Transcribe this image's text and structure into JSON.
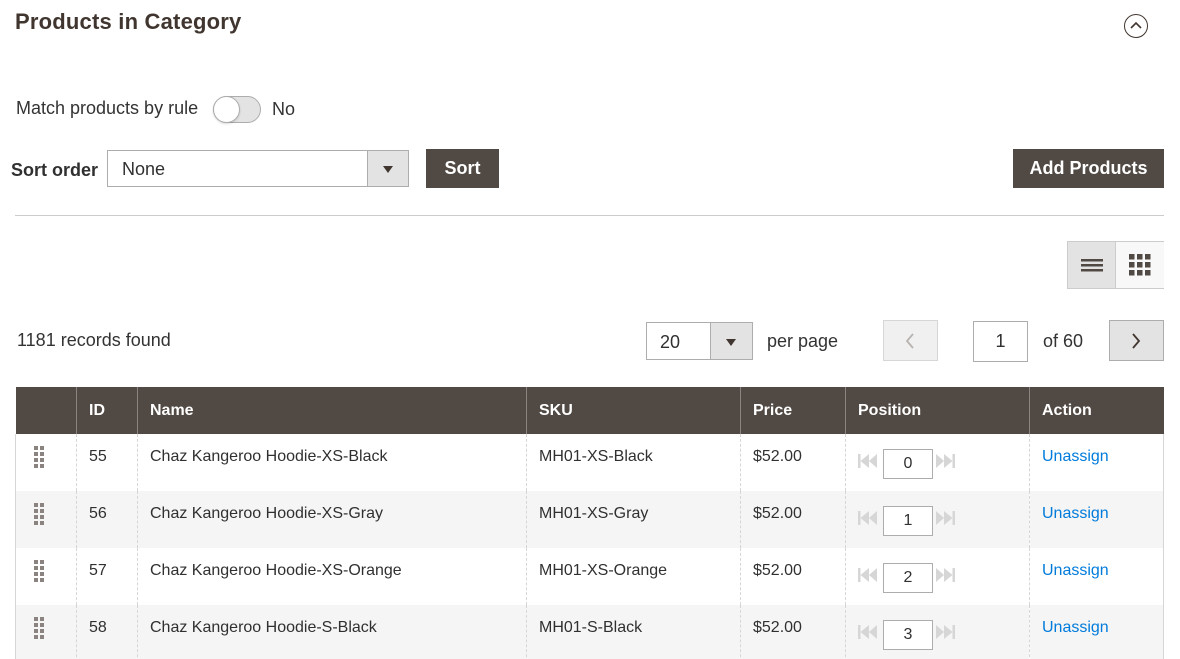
{
  "section": {
    "title": "Products in Category"
  },
  "match_rule": {
    "label": "Match products by rule",
    "state_text": "No"
  },
  "sort": {
    "label": "Sort order",
    "selected": "None",
    "button_label": "Sort"
  },
  "add_products_label": "Add Products",
  "grid": {
    "records_text": "1181 records found",
    "per_page_value": "20",
    "per_page_label": "per page",
    "current_page": "1",
    "of_pages": "of 60",
    "columns": [
      "",
      "ID",
      "Name",
      "SKU",
      "Price",
      "Position",
      "Action"
    ],
    "rows": [
      {
        "id": "55",
        "name": "Chaz Kangeroo Hoodie-XS-Black",
        "sku": "MH01-XS-Black",
        "price": "$52.00",
        "position": "0",
        "action": "Unassign"
      },
      {
        "id": "56",
        "name": "Chaz Kangeroo Hoodie-XS-Gray",
        "sku": "MH01-XS-Gray",
        "price": "$52.00",
        "position": "1",
        "action": "Unassign"
      },
      {
        "id": "57",
        "name": "Chaz Kangeroo Hoodie-XS-Orange",
        "sku": "MH01-XS-Orange",
        "price": "$52.00",
        "position": "2",
        "action": "Unassign"
      },
      {
        "id": "58",
        "name": "Chaz Kangeroo Hoodie-S-Black",
        "sku": "MH01-S-Black",
        "price": "$52.00",
        "position": "3",
        "action": "Unassign"
      }
    ]
  },
  "icons": {
    "collapse": "chevron-up-circle-icon",
    "list_view": "list-view-icon",
    "grid_view": "grid-view-icon",
    "prev": "chevron-left-icon",
    "next": "chevron-right-icon",
    "drag": "drag-handle-icon",
    "first": "move-first-icon",
    "last": "move-last-icon"
  },
  "colors": {
    "header_bg": "#514943",
    "button_bg": "#514943",
    "link": "#007bdb",
    "title": "#41362f"
  }
}
